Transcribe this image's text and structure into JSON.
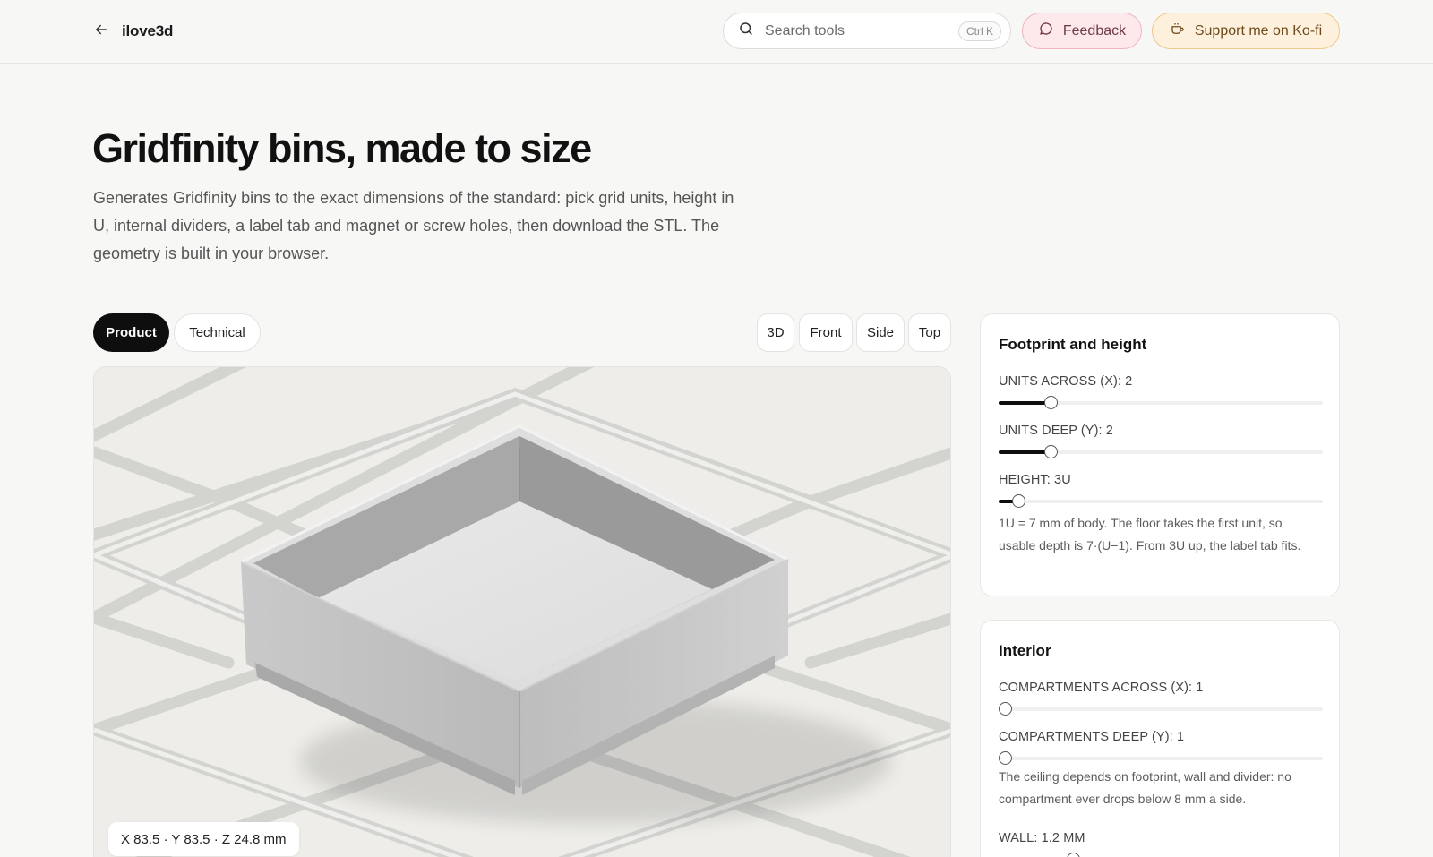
{
  "header": {
    "brand": "ilove3d",
    "search_placeholder": "Search tools",
    "search_shortcut": "Ctrl K",
    "feedback_label": "Feedback",
    "support_label": "Support me on Ko-fi"
  },
  "hero": {
    "title": "Gridfinity bins, made to size",
    "subtitle": "Generates Gridfinity bins to the exact dimensions of the standard: pick grid units, height in U, internal dividers, a label tab and magnet or screw holes, then download the STL. The geometry is built in your browser."
  },
  "tabs": {
    "product": "Product",
    "technical": "Technical",
    "active": "Product"
  },
  "views": {
    "v3d": "3D",
    "front": "Front",
    "side": "Side",
    "top": "Top"
  },
  "viewport": {
    "dims": "X 83.5 · Y 83.5 · Z 24.8 mm"
  },
  "footprint": {
    "title": "Footprint and height",
    "units_across_label": "UNITS ACROSS (X): 2",
    "units_across_level": 0.16,
    "units_deep_label": "UNITS DEEP (Y): 2",
    "units_deep_level": 0.16,
    "height_label": "HEIGHT: 3U",
    "height_level": 0.06,
    "help": "1U = 7 mm of body. The floor takes the first unit, so usable depth is 7·(U−1). From 3U up, the label tab fits."
  },
  "interior": {
    "title": "Interior",
    "comp_across_label": "COMPARTMENTS ACROSS (X): 1",
    "comp_across_level": 0,
    "comp_deep_label": "COMPARTMENTS DEEP (Y): 1",
    "comp_deep_level": 0,
    "help": "The ceiling depends on footprint, wall and divider: no compartment ever drops below 8 mm a side.",
    "wall_label": "WALL: 1.2 MM",
    "wall_level": 0.23
  }
}
